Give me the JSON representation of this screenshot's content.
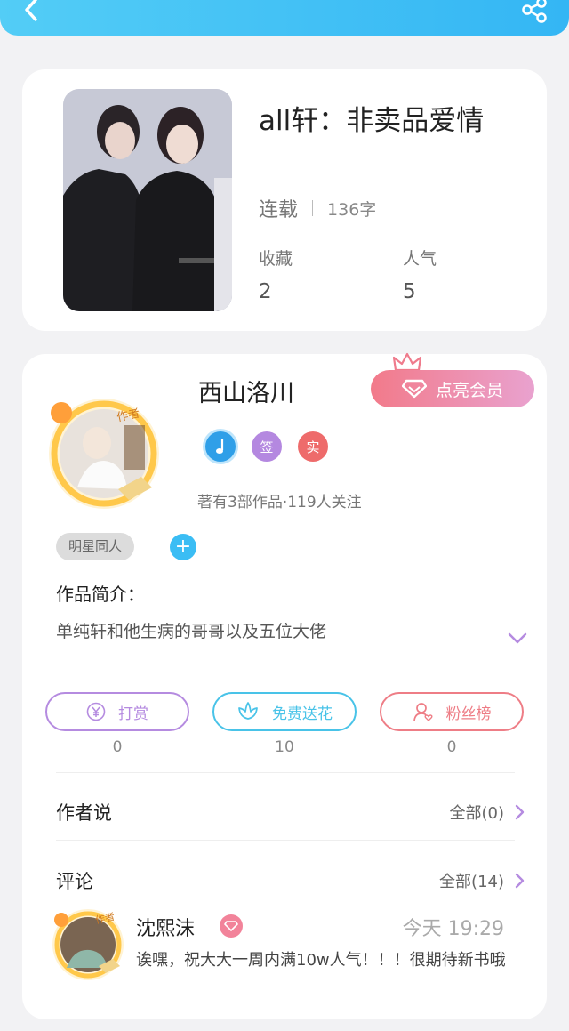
{
  "header": {
    "back_icon": "chevron-left-icon",
    "share_icon": "share-icon"
  },
  "book": {
    "title": "all轩：非卖品爱情",
    "status": "连载",
    "word_count": "136字",
    "favorites_label": "收藏",
    "favorites_value": "2",
    "popularity_label": "人气",
    "popularity_value": "5"
  },
  "author": {
    "name": "西山洛川",
    "vip_button": "点亮会员",
    "badges": [
      {
        "icon": "music-note-icon",
        "color": "#2f9fe8"
      },
      {
        "text": "签",
        "color": "#b488e0"
      },
      {
        "text": "实",
        "color": "#ee6b6b"
      }
    ],
    "meta": "著有3部作品·119人关注",
    "avatar_label": "作者",
    "tag": "明星同人",
    "tag_add": "+"
  },
  "intro": {
    "title": "作品简介：",
    "text": "单纯轩和他生病的哥哥以及五位大佬"
  },
  "actions": [
    {
      "label": "打赏",
      "count": "0",
      "color": "#b58be0",
      "icon": "yen-icon"
    },
    {
      "label": "免费送花",
      "count": "10",
      "color": "#49c3e8",
      "icon": "flower-icon"
    },
    {
      "label": "粉丝榜",
      "count": "0",
      "color": "#ee7d86",
      "icon": "fans-icon"
    }
  ],
  "author_says": {
    "title": "作者说",
    "link": "全部(0)"
  },
  "comments": {
    "title": "评论",
    "link": "全部(14)",
    "items": [
      {
        "avatar_label": "作者",
        "name": "沈熙沫",
        "time": "今天 19:29",
        "text": "诶嘿，祝大大一周内满10w人气！！！很期待新书哦"
      }
    ]
  },
  "colors": {
    "accent": "#3bbdf4",
    "vip_start": "#f27a8a",
    "vip_end": "#e9a2cf"
  }
}
